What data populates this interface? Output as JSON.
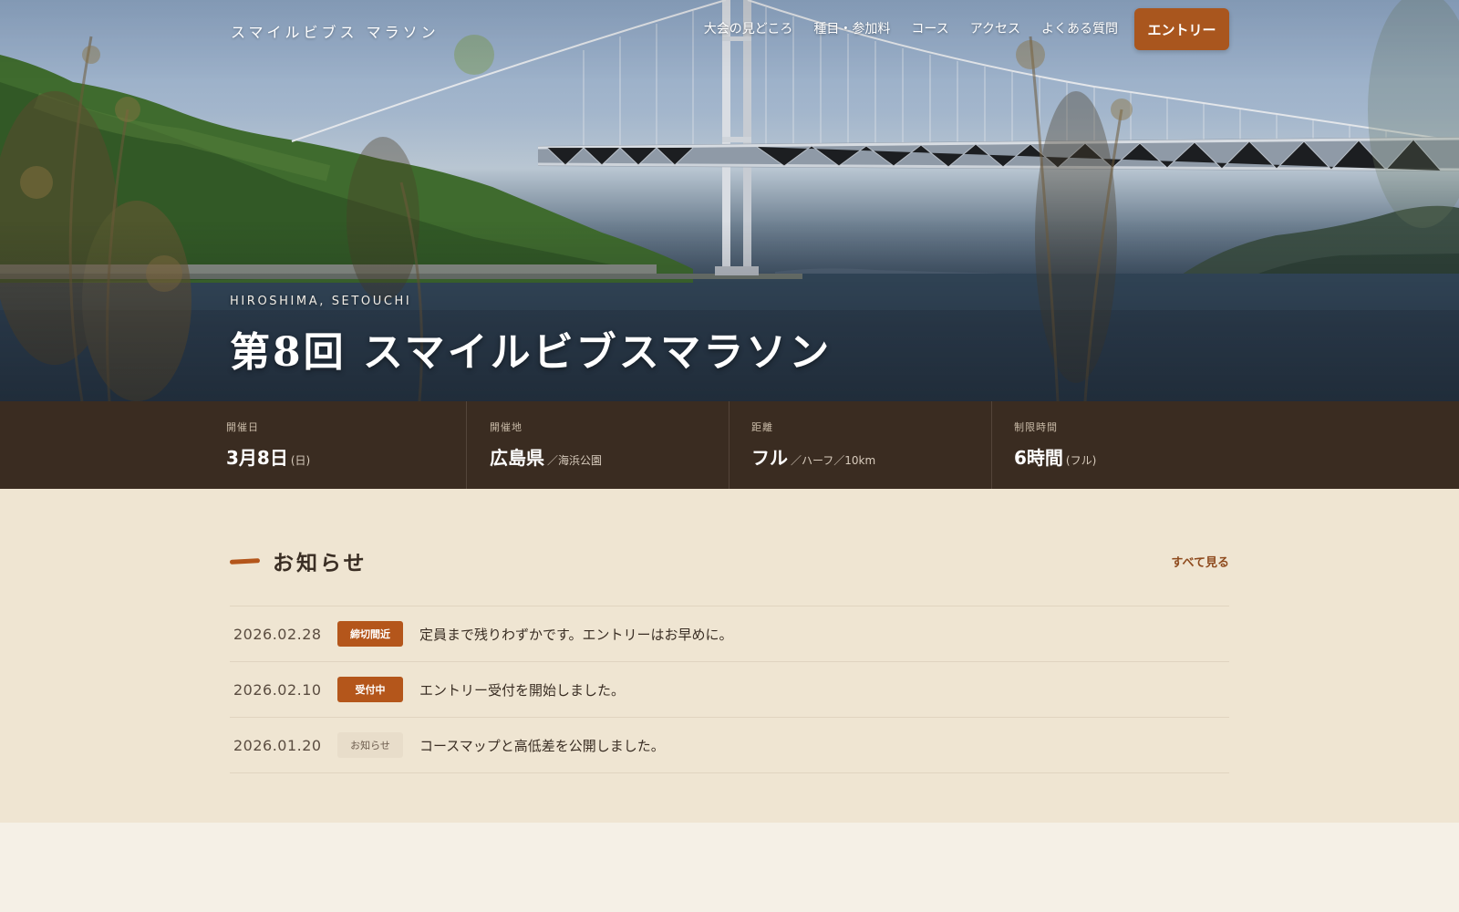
{
  "site": {
    "logo": "スマイルビブス マラソン"
  },
  "nav": {
    "items": [
      "大会の見どころ",
      "種目・参加料",
      "コース",
      "アクセス",
      "よくある質問"
    ],
    "entry_label": "エントリー",
    "entry_color": "#a9561e"
  },
  "hero": {
    "subtitle": "HIROSHIMA, SETOUCHI",
    "title": "第8回 スマイルビブスマラソン"
  },
  "info": [
    {
      "label": "開催日",
      "value": "3月8日",
      "note": "(日)"
    },
    {
      "label": "開催地",
      "value": "広島県",
      "note": "／海浜公園"
    },
    {
      "label": "距離",
      "value": "フル",
      "note": "／ハーフ／10km"
    },
    {
      "label": "制限時間",
      "value": "6時間",
      "note": "(フル)"
    }
  ],
  "news": {
    "title": "お知らせ",
    "see_all": "すべて見る",
    "items": [
      {
        "date": "2026.02.28",
        "badge": "締切間近",
        "text": "定員まで残りわずかです。エントリーはお早めに。"
      },
      {
        "date": "2026.02.10",
        "badge": "受付中",
        "text": "エントリー受付を開始しました。"
      },
      {
        "date": "2026.01.20",
        "badge": "お知らせ",
        "text": "コースマップと高低差を公開しました。"
      }
    ]
  },
  "colors": {
    "accent": "#b4561b",
    "infobar": "#3a2c21",
    "news_bg": "#efe5d2"
  }
}
